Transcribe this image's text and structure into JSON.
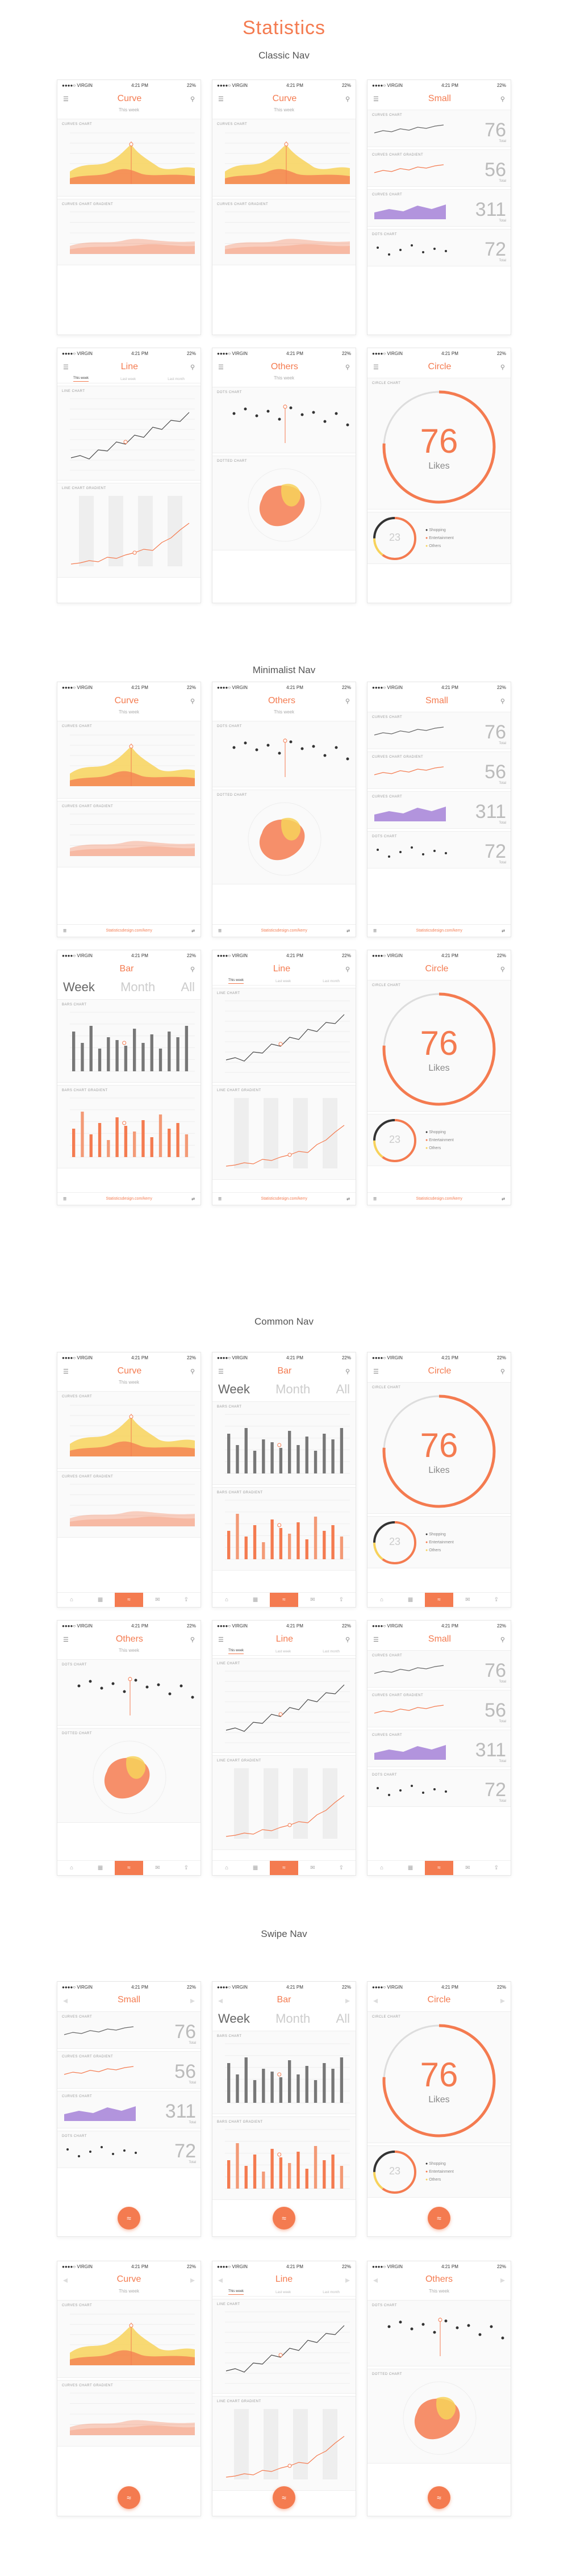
{
  "page": {
    "title": "Statistics",
    "sections": [
      "Classic Nav",
      "Minimalist Nav",
      "Common Nav",
      "Swipe Nav"
    ]
  },
  "status": {
    "carrier": "●●●●○ VIRGIN",
    "time": "4:21 PM",
    "battery": "22%"
  },
  "titles": {
    "curve": "Curve",
    "small": "Small",
    "line": "Line",
    "bar": "Bar",
    "circle": "Circle",
    "others": "Others"
  },
  "subtab": "This week",
  "labels": {
    "curves": "Curves chart",
    "curves_gradient": "Curves chart gradient",
    "dots": "Dots chart",
    "dotted": "Dotted chart",
    "line": "Line chart",
    "line_gradient": "Line chart gradient",
    "bars": "Bars chart",
    "bars_gradient": "Bars chart gradient",
    "circle": "Circle chart"
  },
  "tabs3": [
    "This week",
    "Last week",
    "Last month"
  ],
  "bigtabs": [
    "Week",
    "Month",
    "All"
  ],
  "numbers": {
    "n76": "76",
    "n56": "56",
    "n311": "311",
    "n72": "72",
    "likes": "Likes",
    "total": "Total",
    "n23": "23"
  },
  "legend": [
    "Shopping",
    "Entertainment",
    "Others"
  ],
  "footer_link": "Statisticsdesign.com/kerry",
  "colors": {
    "accent": "#f47b50",
    "yellow": "#f7d25b",
    "purple": "#a07ad6",
    "grey": "#d5d5d5"
  }
}
